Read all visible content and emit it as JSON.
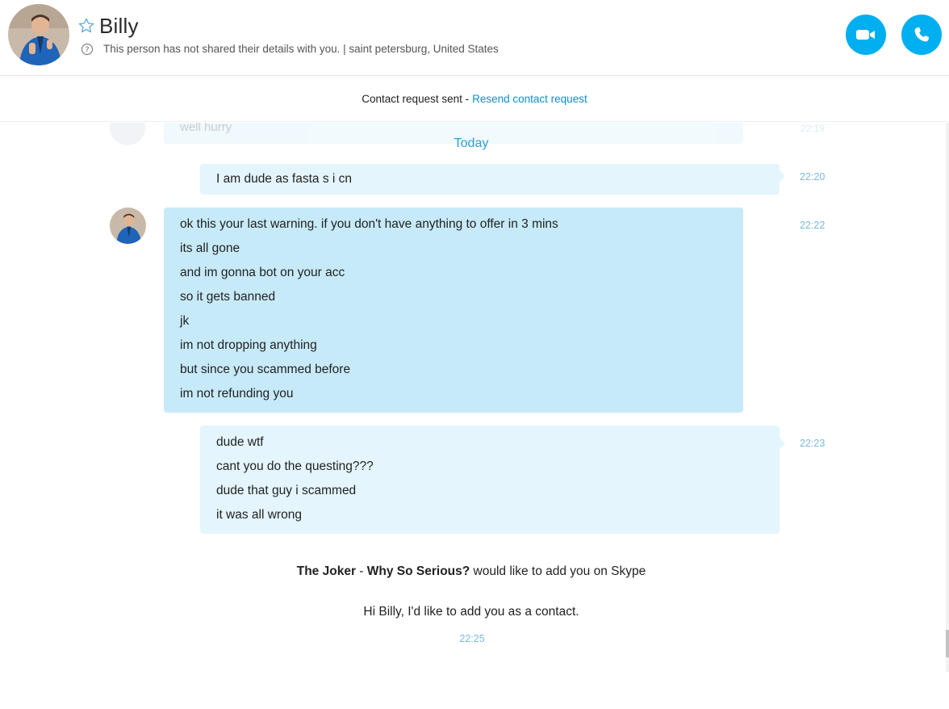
{
  "header": {
    "name": "Billy",
    "subtitle": "This person has not shared their details with you.  |  saint petersburg, United States",
    "favorite_icon": "star-outline-icon",
    "video_icon": "video-camera-icon",
    "call_icon": "phone-icon",
    "accent_color": "#00aff0"
  },
  "request_bar": {
    "status": "Contact request sent -",
    "link": "Resend contact request"
  },
  "conversation": {
    "ghost_message": {
      "text": "well hurry",
      "time": "22:19"
    },
    "day_separator": "Today",
    "messages": [
      {
        "lines": [
          "I am dude as fasta s i cn"
        ],
        "time": "22:20"
      },
      {
        "lines": [
          "ok this your last warning. if you don't have anything to offer in 3 mins",
          "its all gone",
          "and im gonna bot on your acc",
          "so it gets banned",
          "jk",
          "im not dropping anything",
          "but since you scammed before",
          "im not refunding you"
        ],
        "time": "22:22"
      },
      {
        "lines": [
          "dude wtf",
          "cant you do the questing???",
          "dude that guy i scammed",
          "it was all wrong"
        ],
        "time": "22:23"
      }
    ],
    "invite": {
      "sender_name": "The Joker",
      "separator": " - ",
      "sender_status": "Why So Serious?",
      "action": " would like to add you on Skype",
      "message": "Hi Billy, I'd like to add you as a contact.",
      "time": "22:25"
    }
  }
}
